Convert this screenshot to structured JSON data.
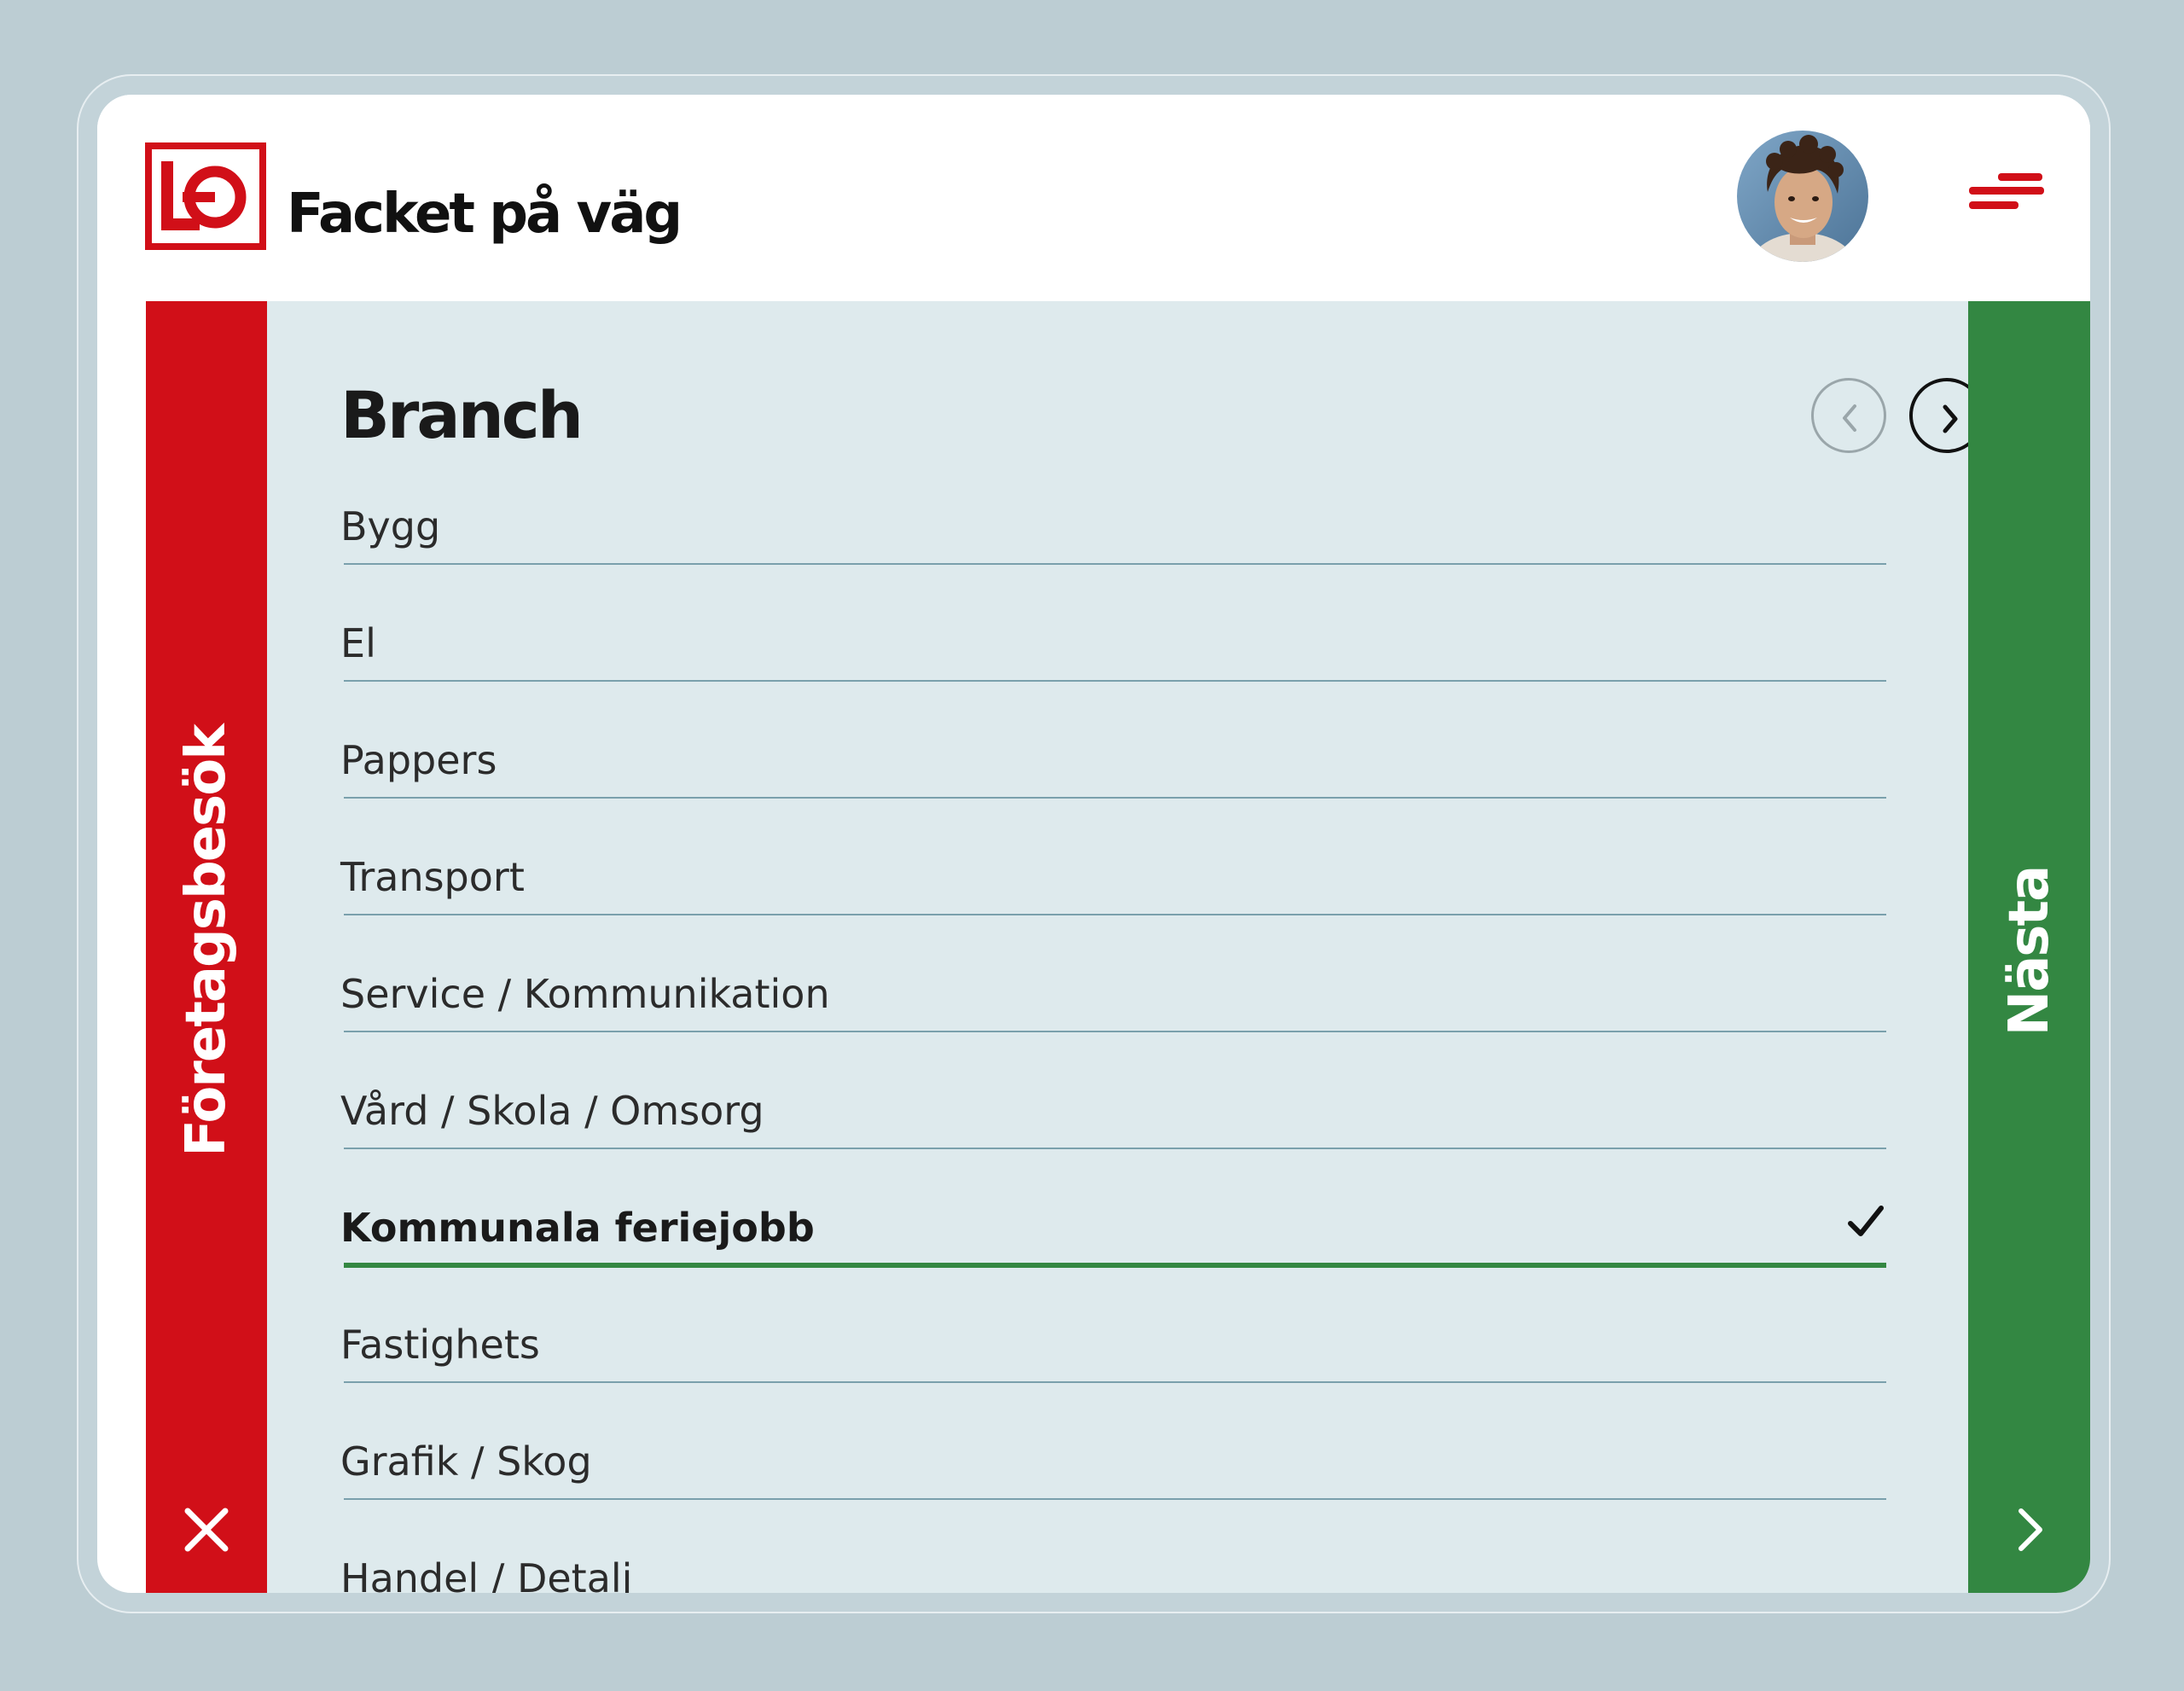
{
  "header": {
    "app_title": "Facket på väg",
    "logo_name": "lo-logo",
    "avatar_name": "user-avatar",
    "menu_icon": "hamburger-menu-icon"
  },
  "left_rail": {
    "label": "Företagsbesök",
    "icon": "close-icon",
    "color": "#d10f18"
  },
  "right_rail": {
    "label": "Nästa",
    "icon": "chevron-right-icon",
    "color": "#338742"
  },
  "main": {
    "title": "Branch",
    "nav": {
      "prev_icon": "chevron-left-icon",
      "next_icon": "chevron-right-icon"
    },
    "items": [
      {
        "label": "Bygg",
        "selected": false
      },
      {
        "label": "El",
        "selected": false
      },
      {
        "label": "Pappers",
        "selected": false
      },
      {
        "label": "Transport",
        "selected": false
      },
      {
        "label": "Service / Kommunikation",
        "selected": false
      },
      {
        "label": "Vård / Skola / Omsorg",
        "selected": false
      },
      {
        "label": "Kommunala feriejobb",
        "selected": true
      },
      {
        "label": "Fastighets",
        "selected": false
      },
      {
        "label": "Grafik / Skog",
        "selected": false
      },
      {
        "label": "Handel / Detalj",
        "selected": false
      }
    ]
  },
  "colors": {
    "background": "#bccdd3",
    "content_bg": "#deeaed",
    "accent_red": "#d10f18",
    "accent_green": "#338742"
  }
}
